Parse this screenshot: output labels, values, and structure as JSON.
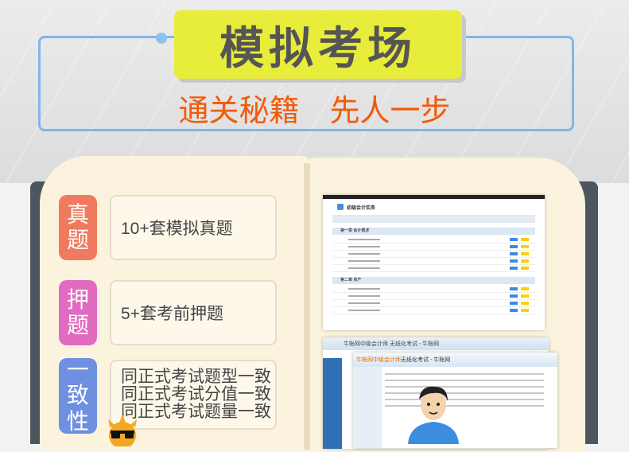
{
  "header": {
    "title": "模拟考场",
    "subtitle": "通关秘籍　先人一步"
  },
  "features": [
    {
      "tag": [
        "真",
        "题"
      ],
      "tag_color": "#f07a5f",
      "lines": [
        "10+套模拟真题"
      ]
    },
    {
      "tag": [
        "押",
        "题"
      ],
      "tag_color": "#e16bc0",
      "lines": [
        "5+套考前押题"
      ]
    },
    {
      "tag": [
        "一",
        "致",
        "性"
      ],
      "tag_color": "#6f8fe0",
      "lines": [
        "同正式考试题型一致",
        "同正式考试分值一致",
        "同正式考试题量一致"
      ]
    }
  ],
  "screenshot_exam_list": {
    "heading": "初级会计实务",
    "sections": [
      "第一章 会计概述",
      "第二章 资产"
    ]
  },
  "screenshot_exam_window": {
    "back_title": "牛账网中级会计师 无纸化考试 - 牛账网",
    "front_title_brand": "牛账网中级会计师",
    "front_title_rest": " 无纸化考试 - 牛账网"
  },
  "colors": {
    "accent_yellow": "#e8ec3a",
    "subtitle_orange": "#f25a0a",
    "frame_blue": "#82b5e8"
  }
}
